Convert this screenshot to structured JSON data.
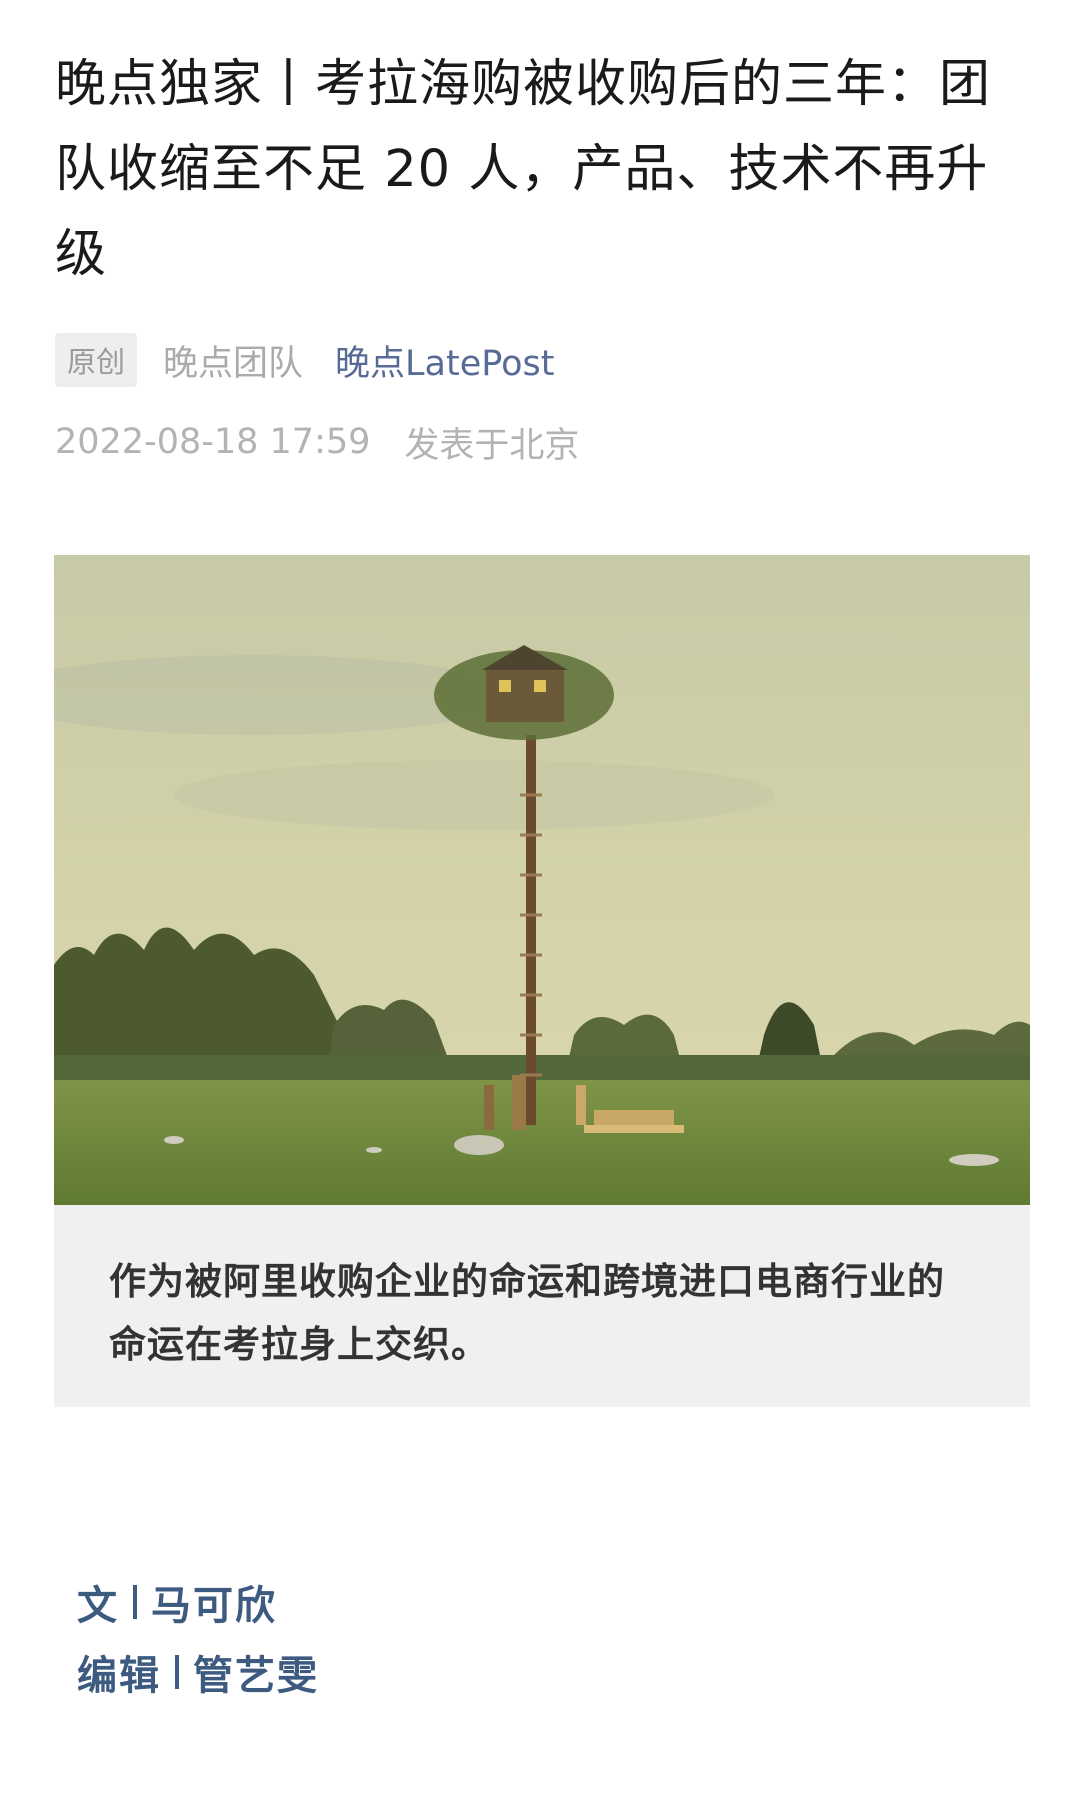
{
  "article": {
    "title": "晚点独家丨考拉海购被收购后的三年：团队收缩至不足 20 人，产品、技术不再升级",
    "original_badge": "原创",
    "team": "晚点团队",
    "account": "晚点LatePost",
    "date": "2022-08-18 17:59",
    "location": "发表于北京",
    "caption": "作为被阿里收购企业的命运和跨境进口电商行业的命运在考拉身上交织。",
    "credits": [
      {
        "label": "文",
        "name": "马可欣"
      },
      {
        "label": "编辑",
        "name": "管艺雯"
      }
    ]
  },
  "colors": {
    "link": "#576b95",
    "credit": "#3d5a80",
    "caption_bg": "#f0f0f0",
    "sky": "#cfd0a8",
    "grass": "#6f8a3e"
  }
}
